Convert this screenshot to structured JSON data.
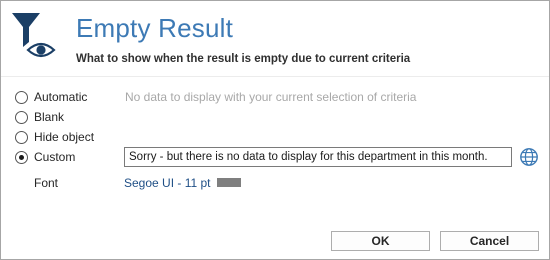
{
  "header": {
    "title": "Empty Result",
    "subtitle": "What to show when the result is empty due to current criteria",
    "icon": "filter-eye-icon",
    "accent_color": "#3d7ab5",
    "icon_color": "#1b3f66"
  },
  "options": {
    "automatic": {
      "label": "Automatic",
      "hint": "No data to display with your current selection of criteria",
      "selected": false
    },
    "blank": {
      "label": "Blank",
      "selected": false
    },
    "hide_object": {
      "label": "Hide object",
      "selected": false
    },
    "custom": {
      "label": "Custom",
      "selected": true,
      "value": "Sorry - but there is no data to display for this department in this month."
    }
  },
  "font": {
    "label": "Font",
    "value": "Segoe UI - 11 pt",
    "color": "#7f7f7f"
  },
  "buttons": {
    "ok": "OK",
    "cancel": "Cancel"
  }
}
